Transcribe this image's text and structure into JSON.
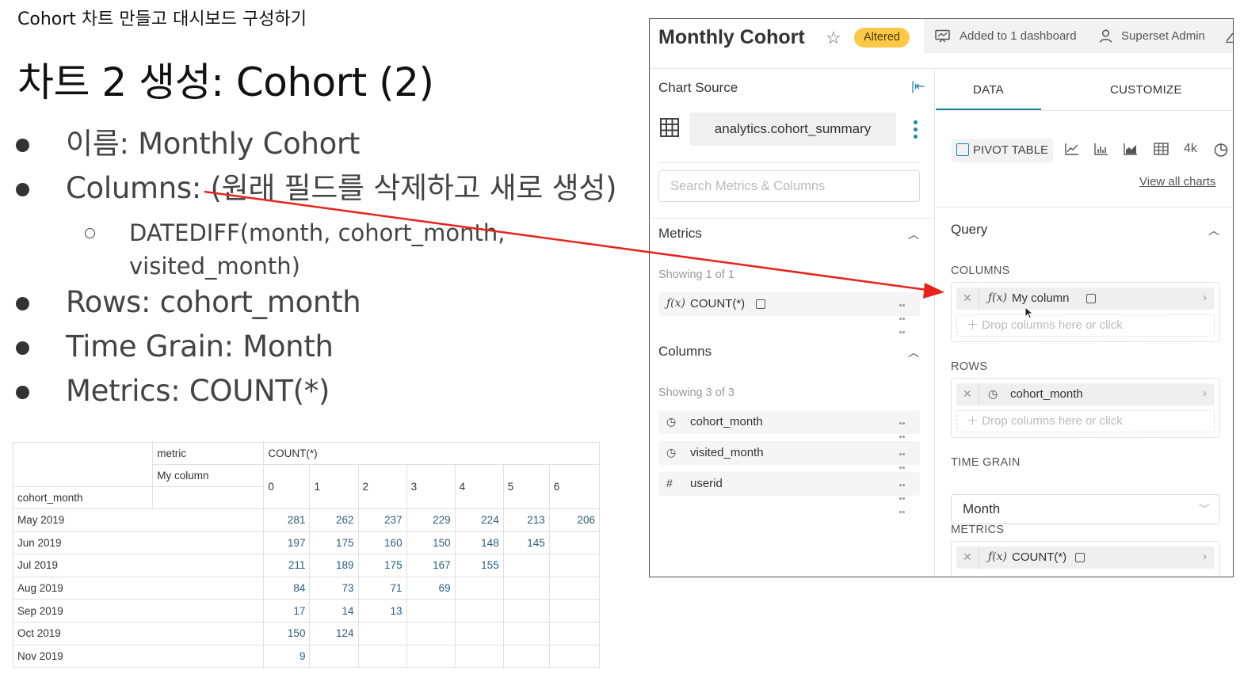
{
  "slide": {
    "header": "Cohort 차트 만들고 대시보드 구성하기",
    "title": "차트 2 생성: Cohort (2)",
    "bullets": [
      "이름: Monthly Cohort",
      "Columns: (원래 필드를 삭제하고 새로 생성)",
      "Rows: cohort_month",
      "Time Grain: Month",
      "Metrics: COUNT(*)"
    ],
    "sub_bullet": {
      "line1": "DATEDIFF(month, cohort_month,",
      "line2": "visited_month)"
    },
    "annotation_arrow_color": "#e8231c"
  },
  "pivot_table": {
    "metric_label": "metric",
    "column_label": "My column",
    "row_label": "cohort_month",
    "metric_name": "COUNT(*)",
    "column_values": [
      "0",
      "1",
      "2",
      "3",
      "4",
      "5",
      "6"
    ],
    "rows": [
      {
        "label": "May 2019",
        "values": [
          "281",
          "262",
          "237",
          "229",
          "224",
          "213",
          "206"
        ]
      },
      {
        "label": "Jun 2019",
        "values": [
          "197",
          "175",
          "160",
          "150",
          "148",
          "145",
          ""
        ]
      },
      {
        "label": "Jul 2019",
        "values": [
          "211",
          "189",
          "175",
          "167",
          "155",
          "",
          ""
        ]
      },
      {
        "label": "Aug 2019",
        "values": [
          "84",
          "73",
          "71",
          "69",
          "",
          "",
          ""
        ]
      },
      {
        "label": "Sep 2019",
        "values": [
          "17",
          "14",
          "13",
          "",
          "",
          "",
          ""
        ]
      },
      {
        "label": "Oct 2019",
        "values": [
          "150",
          "124",
          "",
          "",
          "",
          "",
          ""
        ]
      },
      {
        "label": "Nov 2019",
        "values": [
          "9",
          "",
          "",
          "",
          "",
          "",
          ""
        ]
      }
    ]
  },
  "app": {
    "chart_title": "Monthly Cohort",
    "status_badge": "Altered",
    "dashboards": "Added to 1 dashboard",
    "owner": "Superset Admin",
    "accent_color": "#1a85a0",
    "badge_color": "#fcc847",
    "chart_source": {
      "label": "Chart Source",
      "dataset": "analytics.cohort_summary",
      "search_placeholder": "Search Metrics & Columns"
    },
    "metrics_section": {
      "title": "Metrics",
      "showing": "Showing 1 of 1",
      "items": [
        {
          "name": "COUNT(*)",
          "icon": "function-icon"
        }
      ]
    },
    "columns_section": {
      "title": "Columns",
      "showing": "Showing 3 of 3",
      "items": [
        {
          "name": "cohort_month",
          "icon": "clock-icon"
        },
        {
          "name": "visited_month",
          "icon": "clock-icon"
        },
        {
          "name": "userid",
          "icon": "hash-icon"
        }
      ]
    },
    "tabs": [
      "DATA",
      "CUSTOMIZE"
    ],
    "active_viz": "PIVOT TABLE",
    "viz_number_label": "4k",
    "view_all_charts": "View all charts",
    "query": {
      "title": "Query",
      "columns_label": "COLUMNS",
      "columns_value": "My column",
      "rows_label": "ROWS",
      "rows_value": "cohort_month",
      "drop_hint": "Drop columns here or click",
      "time_grain_label": "TIME GRAIN",
      "time_grain_value": "Month",
      "metrics_label": "METRICS",
      "metrics_value": "COUNT(*)"
    }
  }
}
